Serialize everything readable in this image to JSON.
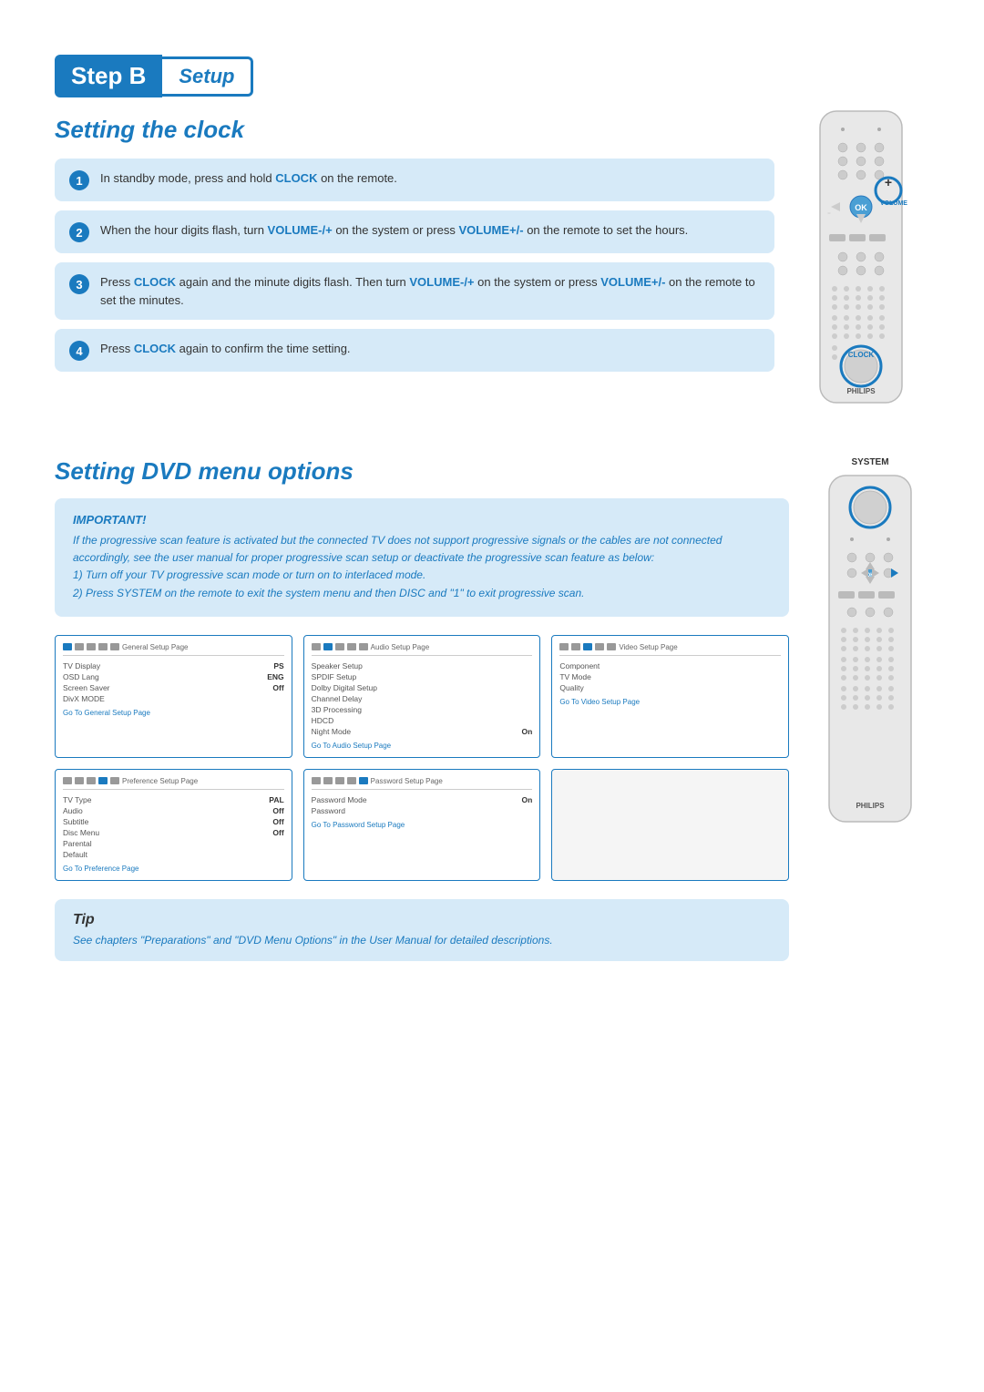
{
  "header": {
    "step_label": "Step B",
    "setup_label": "Setup"
  },
  "clock_section": {
    "title": "Setting the clock",
    "steps": [
      {
        "number": "1",
        "text": "In standby mode, press and hold ",
        "highlight": "CLOCK",
        "text_after": " on the remote."
      },
      {
        "number": "2",
        "text": "When the hour digits flash, turn ",
        "highlight1": "VOLUME-/+",
        "text_mid": " on the system or press ",
        "highlight2": "VOLUME+/-",
        "text_after": " on the remote to set the hours."
      },
      {
        "number": "3",
        "text": "Press ",
        "highlight1": "CLOCK",
        "text_mid1": " again and the minute digits flash. Then turn ",
        "highlight2": "VOLUME-/+",
        "text_mid2": " on the system or press ",
        "highlight3": "VOLUME+/-",
        "text_after": " on the remote to set the minutes."
      },
      {
        "number": "4",
        "text": "Press ",
        "highlight": "CLOCK",
        "text_after": " again to confirm the time setting."
      }
    ]
  },
  "dvd_section": {
    "title": "Setting DVD menu options",
    "important_title": "IMPORTANT!",
    "important_lines": [
      "If the progressive scan feature is activated but the connected TV does not support",
      "progressive signals or the cables are not connected accordingly, see the user",
      "manual for proper progressive scan setup or deactivate the progressive scan",
      "feature as below:",
      "1) Turn off your TV progressive scan mode or turn on to interlaced mode.",
      "2) Press SYSTEM on the remote to exit the system menu and then DISC and \"1\"",
      "to exit progressive scan."
    ],
    "menus": {
      "row1": [
        {
          "title": "General Setup Page",
          "rows": [
            {
              "label": "TV Display",
              "val": "PS"
            },
            {
              "label": "OSD Lang",
              "val": "ENG"
            },
            {
              "label": "Screen Saver",
              "val": "Off"
            },
            {
              "label": "DivX MODE",
              "val": ""
            }
          ],
          "link": "Go To General Setup Page"
        },
        {
          "title": "Audio Setup Page",
          "rows": [
            {
              "label": "Speaker Setup",
              "val": ""
            },
            {
              "label": "SPDIF Setup",
              "val": ""
            },
            {
              "label": "Dolby Digital Setup",
              "val": ""
            },
            {
              "label": "Channel Delay",
              "val": ""
            },
            {
              "label": "3D Processing",
              "val": ""
            },
            {
              "label": "HDCD",
              "val": ""
            },
            {
              "label": "Night Mode",
              "val": "On"
            }
          ],
          "link": "Go To Audio Setup Page"
        },
        {
          "title": "Video Setup Page",
          "rows": [
            {
              "label": "Component",
              "val": ""
            },
            {
              "label": "TV Mode",
              "val": ""
            },
            {
              "label": "Quality",
              "val": ""
            }
          ],
          "link": "Go To Video Setup Page"
        }
      ],
      "row2": [
        {
          "title": "Preference Setup Page",
          "rows": [
            {
              "label": "TV Type",
              "val": "PAL"
            },
            {
              "label": "Audio",
              "val": "Off"
            },
            {
              "label": "Subtitle",
              "val": "Off"
            },
            {
              "label": "Disc Menu",
              "val": "Off"
            },
            {
              "label": "Parental",
              "val": ""
            },
            {
              "label": "Default",
              "val": ""
            }
          ],
          "link": "Go To Preference Page"
        },
        {
          "title": "Password Setup Page",
          "rows": [
            {
              "label": "Password Mode",
              "val": "On"
            },
            {
              "label": "Password",
              "val": ""
            }
          ],
          "link": "Go To Password Setup Page"
        },
        {
          "title": "",
          "rows": [],
          "link": "",
          "empty": true
        }
      ]
    },
    "tip": {
      "title": "Tip",
      "text": "See chapters \"Preparations\" and \"DVD Menu Options\" in the User Manual for detailed descriptions."
    }
  },
  "remote_clock": {
    "label_volume": "VOLUME",
    "label_clock": "CLOCK",
    "label_philips": "PHILIPS"
  },
  "remote_system": {
    "label_system": "SYSTEM",
    "label_philips": "PHILIPS"
  }
}
